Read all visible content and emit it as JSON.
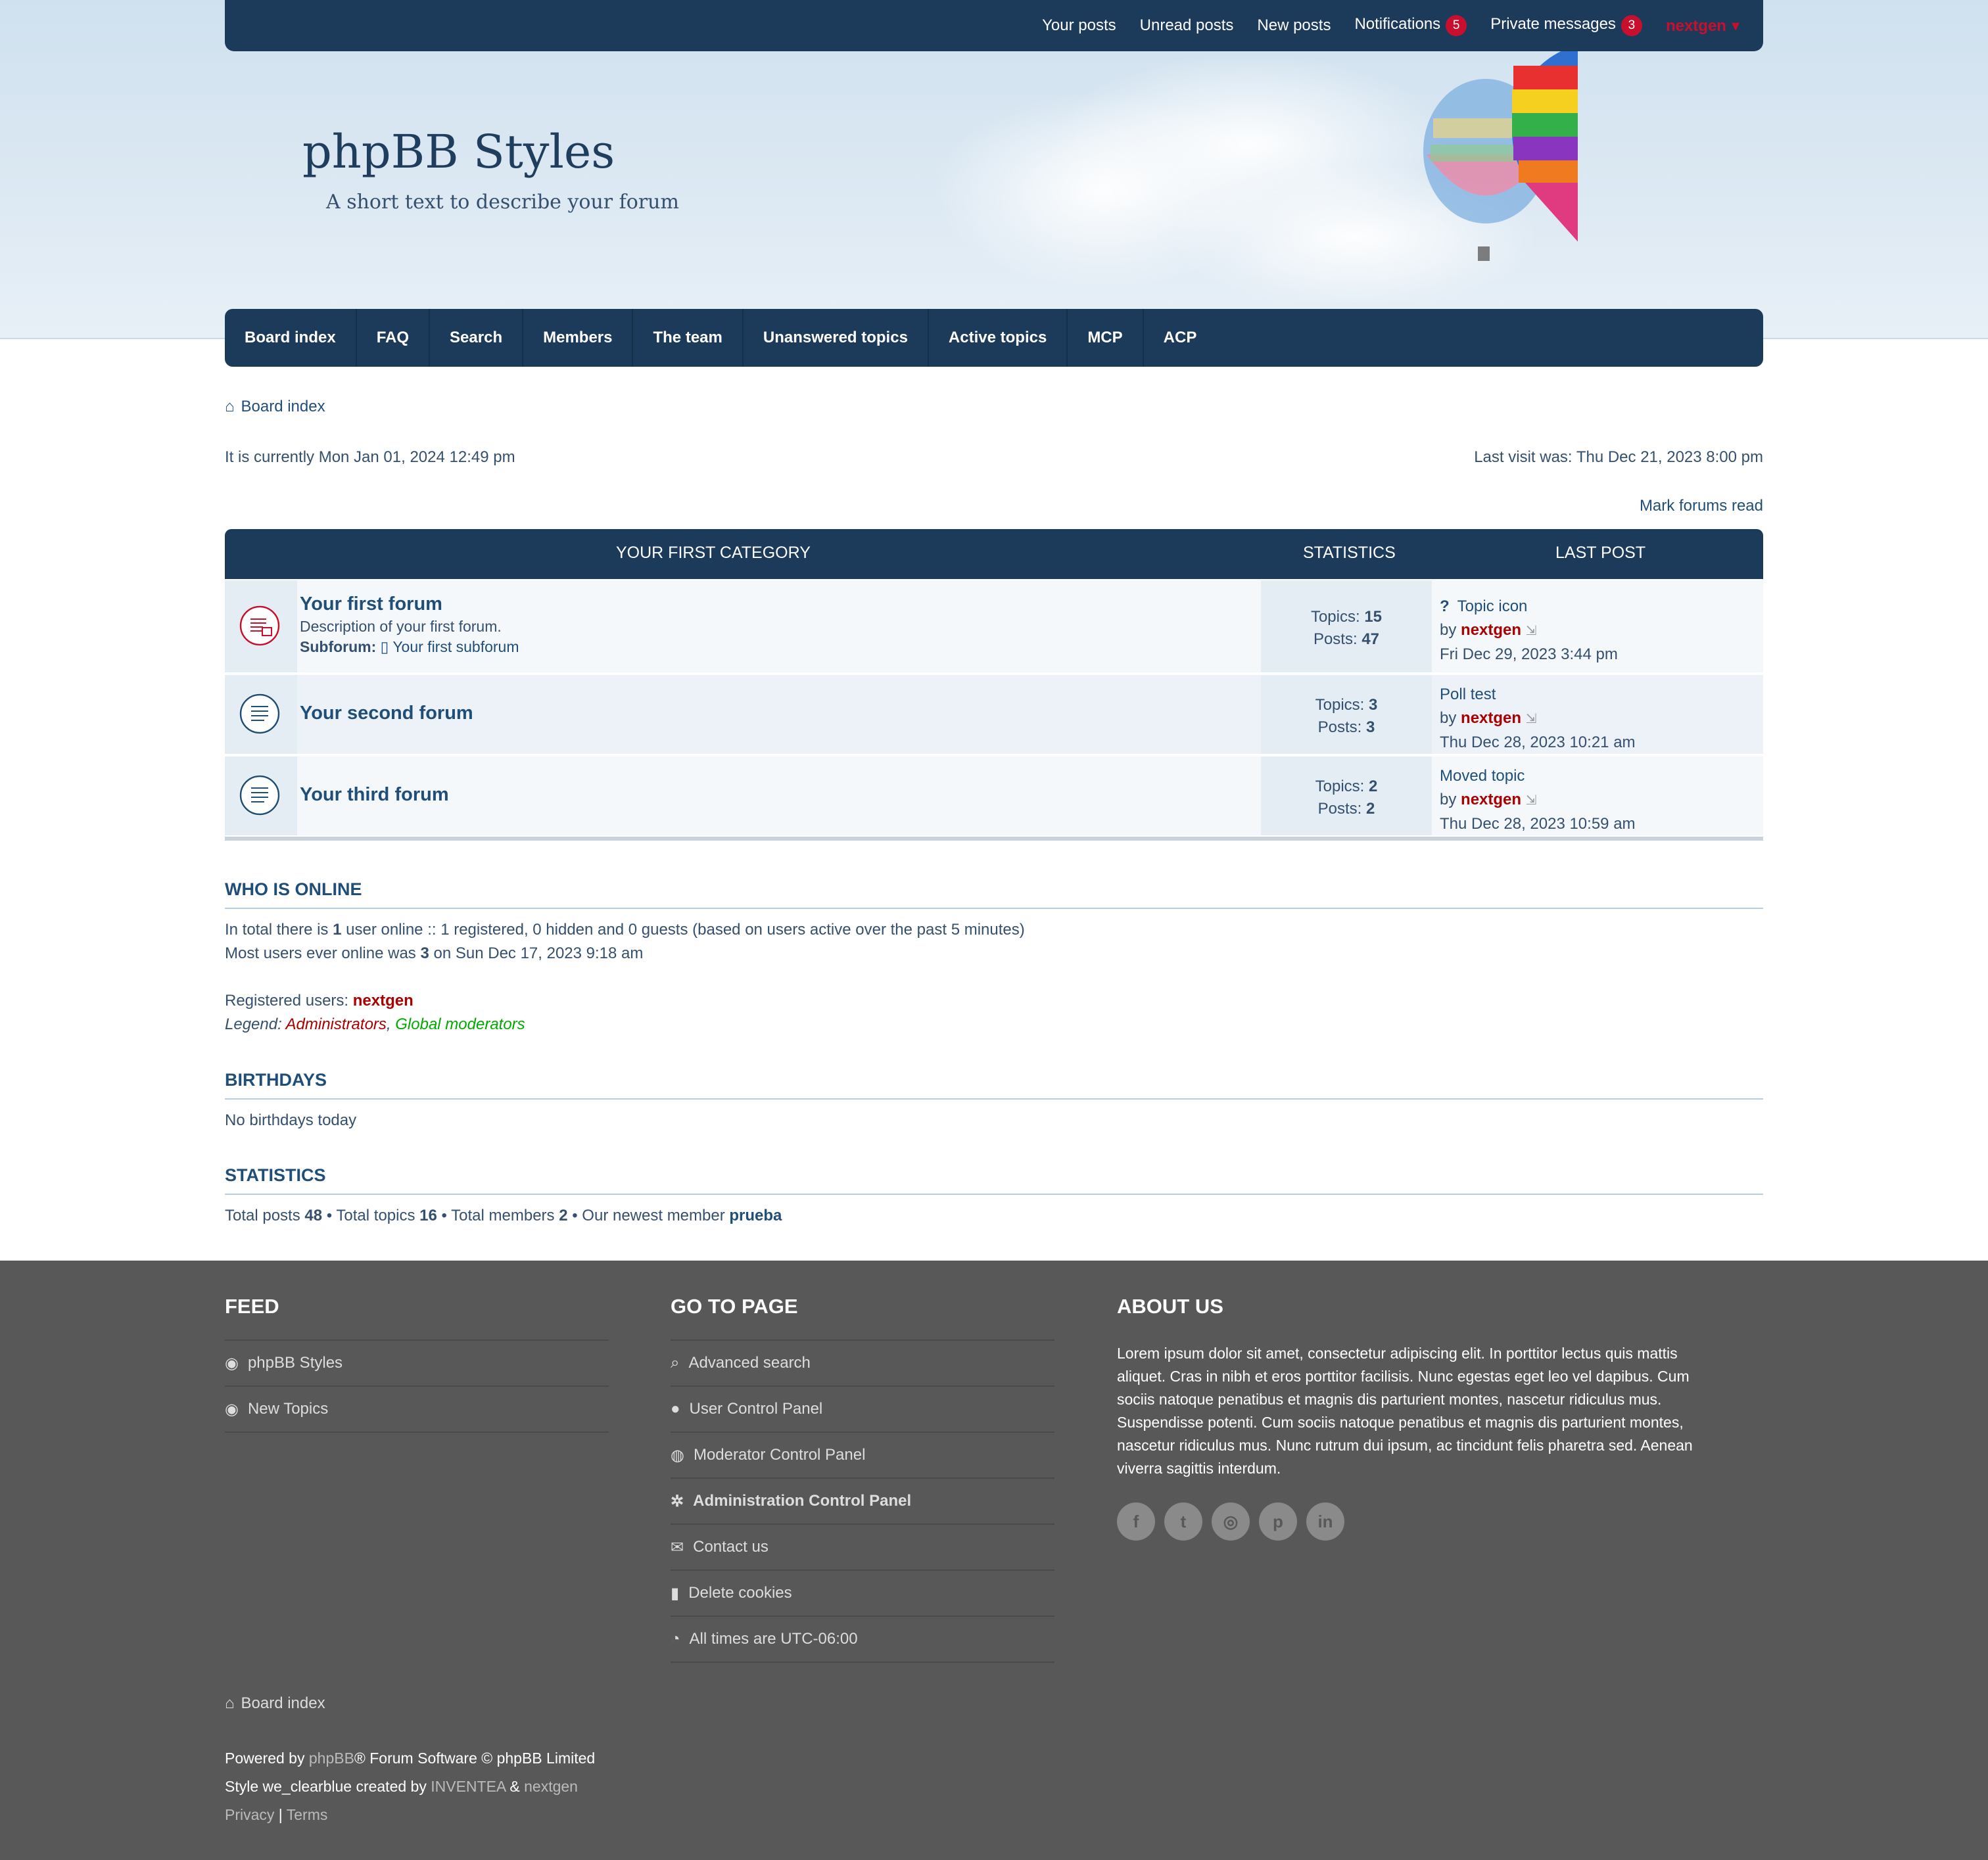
{
  "topbar": {
    "links": [
      "Your posts",
      "Unread posts",
      "New posts"
    ],
    "notifications_label": "Notifications",
    "notifications_count": "5",
    "pm_label": "Private messages",
    "pm_count": "3",
    "username": "nextgen"
  },
  "site": {
    "title": "phpBB Styles",
    "description": "A short text to describe your forum"
  },
  "nav": [
    "Board index",
    "FAQ",
    "Search",
    "Members",
    "The team",
    "Unanswered topics",
    "Active topics",
    "MCP",
    "ACP"
  ],
  "breadcrumb": "Board index",
  "meta": {
    "current": "It is currently Mon Jan 01, 2024 12:49 pm",
    "last_visit": "Last visit was: Thu Dec 21, 2023 8:00 pm",
    "mark_read": "Mark forums read"
  },
  "category": {
    "title": "YOUR FIRST CATEGORY",
    "stats_label": "STATISTICS",
    "last_label": "LAST POST"
  },
  "forums": [
    {
      "title": "Your first forum",
      "desc": "Description of your first forum.",
      "sub_label": "Subforum:",
      "sub": "Your first subforum",
      "topics_label": "Topics:",
      "topics": "15",
      "posts_label": "Posts:",
      "posts": "47",
      "last_title": "Topic icon",
      "by": "by",
      "last_user": "nextgen",
      "last_date": "Fri Dec 29, 2023 3:44 pm"
    },
    {
      "title": "Your second forum",
      "topics_label": "Topics:",
      "topics": "3",
      "posts_label": "Posts:",
      "posts": "3",
      "last_title": "Poll test",
      "by": "by",
      "last_user": "nextgen",
      "last_date": "Thu Dec 28, 2023 10:21 am"
    },
    {
      "title": "Your third forum",
      "topics_label": "Topics:",
      "topics": "2",
      "posts_label": "Posts:",
      "posts": "2",
      "last_title": "Moved topic",
      "by": "by",
      "last_user": "nextgen",
      "last_date": "Thu Dec 28, 2023 10:59 am"
    }
  ],
  "online": {
    "heading": "WHO IS ONLINE",
    "line1_a": "In total there is ",
    "line1_b": "1",
    "line1_c": " user online :: 1 registered, 0 hidden and 0 guests (based on users active over the past 5 minutes)",
    "line2_a": "Most users ever online was ",
    "line2_b": "3",
    "line2_c": " on Sun Dec 17, 2023 9:18 am",
    "registered_label": "Registered users: ",
    "registered_user": "nextgen",
    "legend_label": "Legend: ",
    "legend_admin": "Administrators",
    "legend_sep": ", ",
    "legend_mod": "Global moderators"
  },
  "birthdays": {
    "heading": "BIRTHDAYS",
    "text": "No birthdays today"
  },
  "statistics": {
    "heading": "STATISTICS",
    "a": "Total posts ",
    "posts": "48",
    "b": " • Total topics ",
    "topics": "16",
    "c": " • Total members ",
    "members": "2",
    "d": " • Our newest member ",
    "newest": "prueba"
  },
  "footer": {
    "feed": {
      "heading": "FEED",
      "items": [
        "phpBB Styles",
        "New Topics"
      ]
    },
    "goto": {
      "heading": "GO TO PAGE",
      "items": [
        "Advanced search",
        "User Control Panel",
        "Moderator Control Panel",
        "Administration Control Panel",
        "Contact us",
        "Delete cookies",
        "All times are UTC-06:00"
      ]
    },
    "about": {
      "heading": "ABOUT US",
      "text": "Lorem ipsum dolor sit amet, consectetur adipiscing elit. In porttitor lectus quis mattis aliquet. Cras in nibh et eros porttitor facilisis. Nunc egestas eget leo vel dapibus. Cum sociis natoque penatibus et magnis dis parturient montes, nascetur ridiculus mus. Suspendisse potenti. Cum sociis natoque penatibus et magnis dis parturient montes, nascetur ridiculus mus. Nunc rutrum dui ipsum, ac tincidunt felis pharetra sed. Aenean viverra sagittis interdum."
    },
    "board_index": "Board index",
    "powered_a": "Powered by ",
    "powered_link": "phpBB",
    "powered_b": "® Forum Software © phpBB Limited",
    "style_a": "Style we_clearblue created by ",
    "style_link1": "INVENTEA",
    "style_amp": " & ",
    "style_link2": "nextgen",
    "privacy": "Privacy",
    "sep": " | ",
    "terms": "Terms"
  }
}
